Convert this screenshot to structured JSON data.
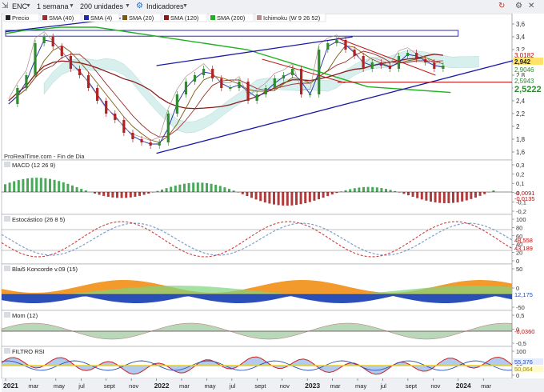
{
  "toolbar": {
    "ticker": "ENC",
    "period": "1 semana",
    "units": "200 unidades",
    "indicators": "Indicadores"
  },
  "colors": {
    "up": "#2e8b2e",
    "down": "#b22222",
    "sma4": "#1f2aa8",
    "sma20": "#7a5a10",
    "sma40": "#9b2f2f",
    "sma120": "#8a1a1a",
    "sma200": "#22b022",
    "ichimoku_span": "#b58d8d",
    "channel": "#1a1aa8"
  },
  "chart_data": [
    {
      "panel": "price",
      "type": "line",
      "title": "",
      "legend": [
        "Precio",
        "SMA (40)",
        "SMA (4)",
        "SMA (20)",
        "SMA (120)",
        "SMA (200)",
        "Ichimoku (W 9 26 52)"
      ],
      "source": "ProRealTime.com - Fin de Dia",
      "ylim": [
        1.5,
        3.7
      ],
      "yticks": [
        "3,6",
        "3,4",
        "3,2",
        "3",
        "2,8",
        "2,6",
        "2,4",
        "2,2",
        "2",
        "1,8",
        "1,6"
      ],
      "last_values": [
        "3,0182",
        "2,942",
        "2,9046",
        "2,5943",
        "2,5222"
      ],
      "x_range": [
        "2021-01",
        "2024-04"
      ],
      "close_series": [
        2.35,
        2.6,
        2.8,
        3.3,
        3.4,
        3.25,
        3.1,
        2.9,
        2.8,
        2.6,
        2.4,
        2.2,
        2.1,
        1.9,
        1.8,
        1.75,
        1.7,
        1.75,
        2.2,
        2.5,
        2.7,
        2.8,
        2.9,
        2.75,
        2.6,
        2.6,
        2.7,
        2.4,
        2.5,
        2.6,
        2.75,
        2.8,
        2.9,
        2.5,
        2.5,
        3.2,
        3.3,
        3.35,
        3.2,
        3.1,
        2.9,
        3.0,
        2.95,
        2.9,
        3.1,
        3.15,
        3.05,
        3.0,
        2.9,
        2.95
      ],
      "sma200_series": [
        3.45,
        3.5,
        3.52,
        3.55,
        3.55,
        3.55
      ],
      "channel_upper": [
        [
          2022.0,
          2.95
        ],
        [
          2023.3,
          3.4
        ]
      ],
      "channel_lower": [
        [
          2022.0,
          1.58
        ],
        [
          2024.4,
          3.05
        ]
      ]
    },
    {
      "panel": "macd",
      "type": "bar",
      "title": "MACD (12 26 9)",
      "yticks": [
        "0,3",
        "0,2",
        "0,1",
        "0",
        "-0,1",
        "-0,2"
      ],
      "last_values": [
        "-0,0091",
        "-0,0135"
      ]
    },
    {
      "panel": "stochastic",
      "type": "line",
      "title": "Estocástico (26 8 5)",
      "yticks": [
        "100",
        "80",
        "60",
        "40",
        "20",
        "0"
      ],
      "last_values": [
        "48,558",
        "43,189"
      ]
    },
    {
      "panel": "koncorde",
      "type": "area",
      "title": "Blai5 Koncorde v.09 (15)",
      "yticks": [
        "50",
        "0",
        "-50"
      ],
      "last_values": [
        "12,175"
      ]
    },
    {
      "panel": "momentum",
      "type": "area",
      "title": "Mom (12)",
      "yticks": [
        "0,5",
        "0",
        "-0,5"
      ],
      "last_values": [
        "-0,0360"
      ]
    },
    {
      "panel": "rsi",
      "type": "line",
      "title": "FILTRO RSI",
      "yticks": [
        "100",
        "50",
        "0"
      ],
      "last_values": [
        "55,376",
        "50,064"
      ]
    }
  ],
  "xaxis": {
    "labels": [
      "2021",
      "mar",
      "may",
      "jul",
      "sept",
      "nov",
      "2022",
      "mar",
      "may",
      "jul",
      "sept",
      "nov",
      "2023",
      "mar",
      "may",
      "jul",
      "sept",
      "nov",
      "2024",
      "mar"
    ],
    "bold": [
      "2021",
      "2022",
      "2023",
      "2024"
    ]
  }
}
